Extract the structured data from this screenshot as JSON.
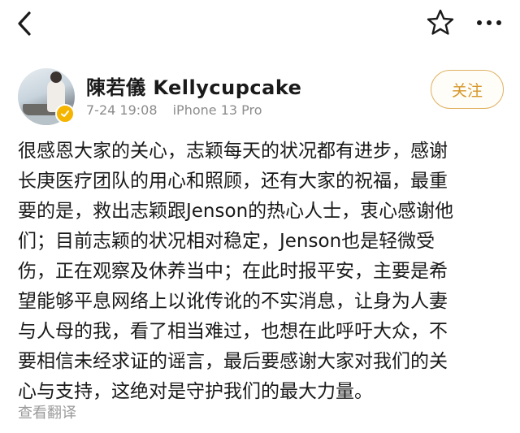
{
  "post": {
    "username": "陳若儀 Kellycupcake",
    "date": "7-24 19:08",
    "device": "iPhone 13 Pro",
    "follow_label": "关注",
    "content_lines": [
      "很感恩大家的关心，志颖每天的状况都有进步，感谢",
      "长庚医疗团队的用心和照顾，还有大家的祝福，最重",
      "要的是，救出志颖跟Jenson的热心人士，衷心感谢他",
      "们；目前志颖的状况相对稳定，Jenson也是轻微受",
      "伤，正在观察及休养当中；在此时报平安，主要是希",
      "望能够平息网络上以讹传讹的不实消息，让身为人妻",
      "与人母的我，看了相当难过，也想在此呼吁大众，不",
      "要相信未经求证的谣言，最后要感谢大家对我们的关",
      "心与支持，这绝对是守护我们的最大力量。"
    ],
    "translate_label": "查看翻译"
  },
  "icons": {
    "back": "chevron-left-icon",
    "favorite": "star-icon",
    "more": "more-dots-icon",
    "verified": "verified-badge-icon"
  },
  "colors": {
    "follow_accent": "#d6962a",
    "verified_badge": "#f5b400",
    "meta_text": "#8c8c8c"
  }
}
